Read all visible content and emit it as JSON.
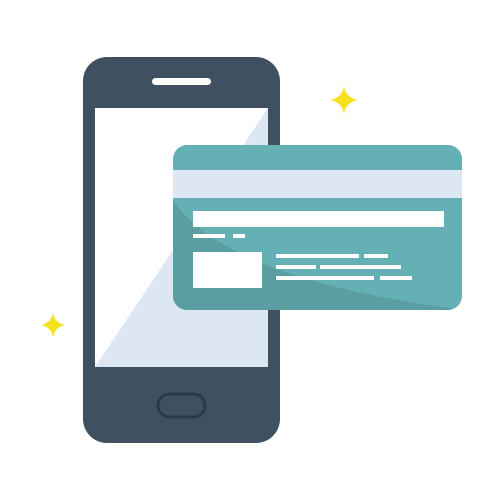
{
  "illustration": {
    "subject": "mobile-payment",
    "icons": [
      "smartphone-icon",
      "credit-card-icon",
      "sparkle-icon"
    ]
  },
  "colors": {
    "background": "#ffffff",
    "phone_body": "#3f5061",
    "phone_screen": "#ffffff",
    "screen_reflection": "#dde7f4",
    "card_face": "#64b0b4",
    "card_shadow": "#5a9ea2",
    "card_stripe": "#dde7f4",
    "card_details": "#ffffff",
    "sparkle": "#f4e01c"
  }
}
